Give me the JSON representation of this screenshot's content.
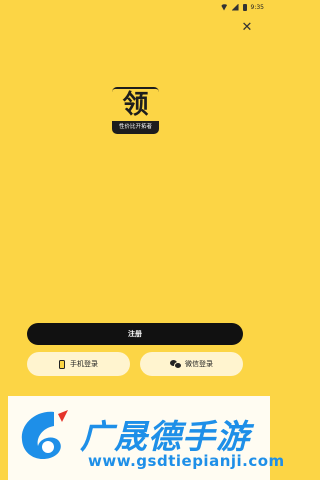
{
  "status_bar": {
    "time": "9:35"
  },
  "header": {
    "close_glyph": "✕"
  },
  "logo": {
    "glyph": "领",
    "caption": "性价比开拓者"
  },
  "actions": {
    "register_label": "注册",
    "phone_login_label": "手机登录",
    "wechat_login_label": "微信登录"
  },
  "watermark": {
    "title": "广晟德手游",
    "url": "www.gsdtiepianji.com"
  },
  "colors": {
    "background": "#FCD545",
    "primary_button": "#111111",
    "secondary_button": "#FFF4CF",
    "watermark_blue": "#1E8FE8",
    "watermark_red": "#E5342B"
  },
  "icons": [
    "wifi-icon",
    "signal-icon",
    "battery-icon",
    "close-icon",
    "phone-icon",
    "wechat-icon"
  ]
}
